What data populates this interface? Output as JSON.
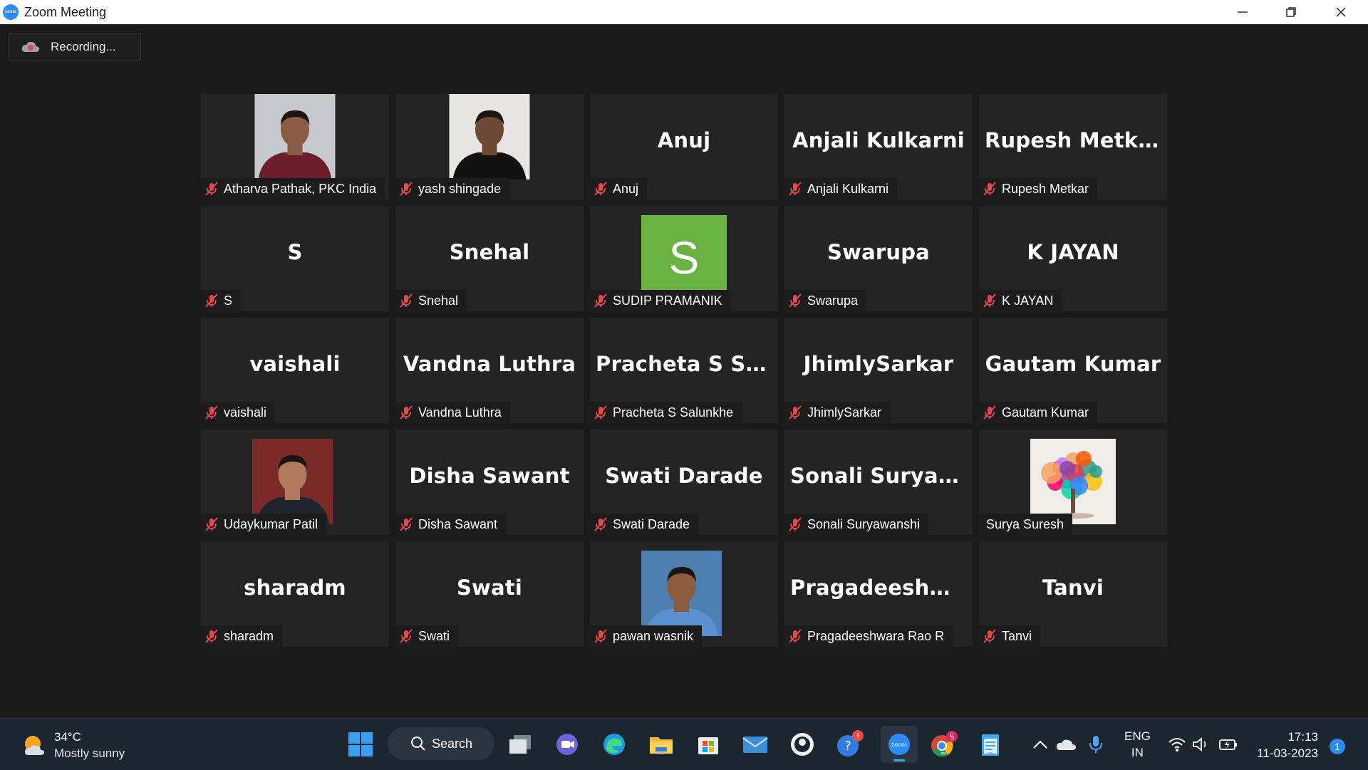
{
  "window": {
    "title": "Zoom Meeting",
    "logo_text": "zoom"
  },
  "recording": {
    "label": "Recording..."
  },
  "participants": [
    {
      "name": "Atharva Pathak, PKC India",
      "display": "",
      "media": "video"
    },
    {
      "name": "yash shingade",
      "display": "",
      "media": "video"
    },
    {
      "name": "Anuj",
      "display": "Anuj",
      "media": "none"
    },
    {
      "name": "Anjali Kulkarni",
      "display": "Anjali Kulkarni",
      "media": "none"
    },
    {
      "name": "Rupesh Metkar",
      "display": "Rupesh Metkar",
      "media": "none"
    },
    {
      "name": "S",
      "display": "S",
      "media": "none"
    },
    {
      "name": "Snehal",
      "display": "Snehal",
      "media": "none"
    },
    {
      "name": "SUDIP PRAMANIK",
      "display": "",
      "media": "avatar",
      "avatar_letter": "S"
    },
    {
      "name": "Swarupa",
      "display": "Swarupa",
      "media": "none"
    },
    {
      "name": "K JAYAN",
      "display": "K JAYAN",
      "media": "none"
    },
    {
      "name": "vaishali",
      "display": "vaishali",
      "media": "none"
    },
    {
      "name": "Vandna Luthra",
      "display": "Vandna Luthra",
      "media": "none"
    },
    {
      "name": "Pracheta S Salunkhe",
      "display": "Pracheta  S  Salu...",
      "media": "none"
    },
    {
      "name": "JhimlySarkar",
      "display": "JhimlySarkar",
      "media": "none"
    },
    {
      "name": "Gautam Kumar",
      "display": "Gautam Kumar",
      "media": "none"
    },
    {
      "name": "Udaykumar Patil",
      "display": "",
      "media": "photo"
    },
    {
      "name": "Disha Sawant",
      "display": "Disha Sawant",
      "media": "none"
    },
    {
      "name": "Swati Darade",
      "display": "Swati Darade",
      "media": "none"
    },
    {
      "name": "Sonali Suryawanshi",
      "display": "Sonali  Suryawa...",
      "media": "none"
    },
    {
      "name": "Surya Suresh",
      "display": "",
      "media": "art",
      "unmuted": true
    },
    {
      "name": "sharadm",
      "display": "sharadm",
      "media": "none"
    },
    {
      "name": "Swati",
      "display": "Swati",
      "media": "none"
    },
    {
      "name": "pawan wasnik",
      "display": "",
      "media": "photo"
    },
    {
      "name": "Pragadeeshwara Rao R",
      "display": "Pragadeeshwar...",
      "media": "none"
    },
    {
      "name": "Tanvi",
      "display": "Tanvi",
      "media": "none"
    }
  ],
  "taskbar": {
    "weather_temp": "34°C",
    "weather_desc": "Mostly sunny",
    "search_label": "Search",
    "lang_line1": "ENG",
    "lang_line2": "IN",
    "time": "17:13",
    "date": "11-03-2023",
    "notification_count": "1",
    "chrome_badge": "S"
  },
  "colors": {
    "avatar_green": "#6ab343",
    "mute_red": "#e5484d",
    "zoom_blue": "#2d8cff"
  }
}
